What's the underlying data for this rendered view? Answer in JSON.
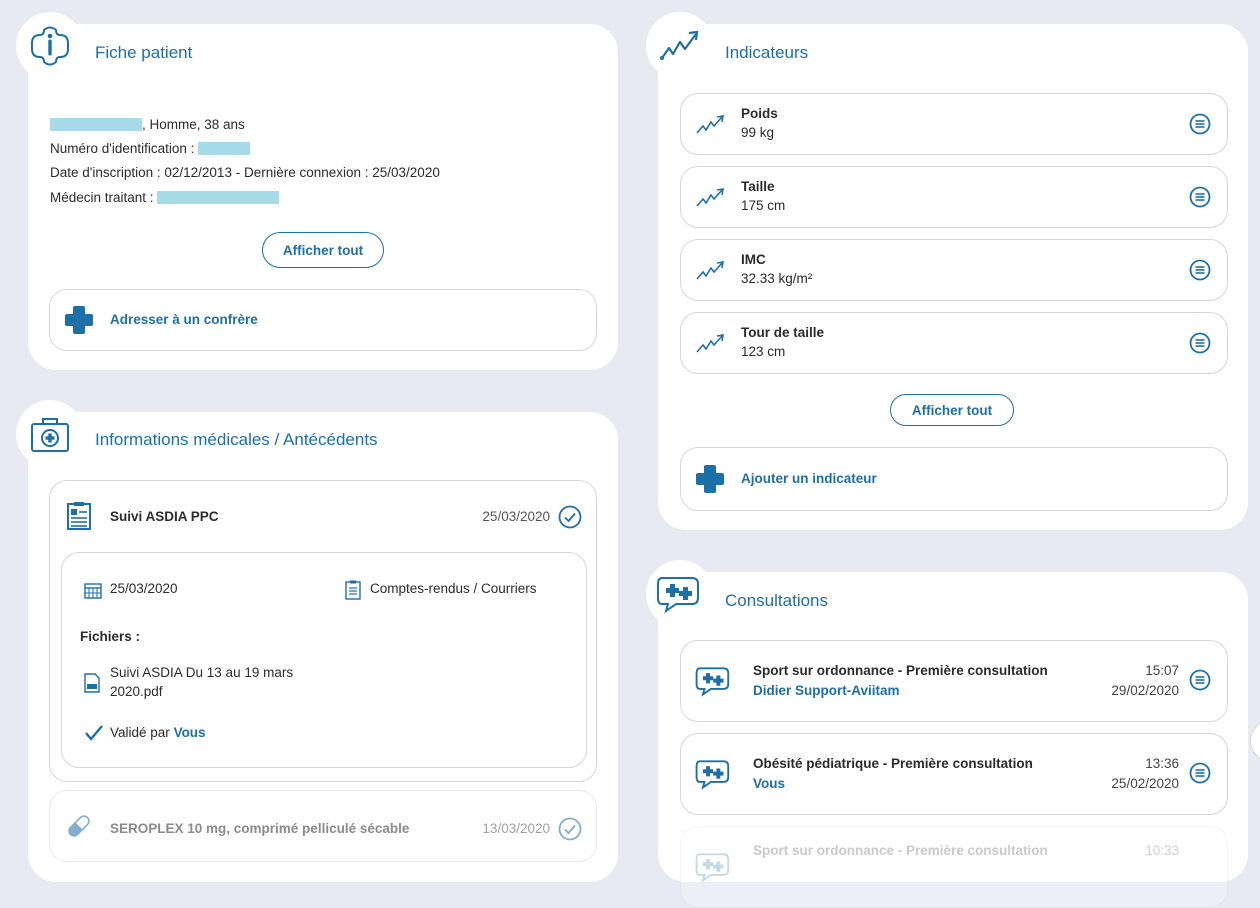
{
  "patient_card": {
    "title": "Fiche patient",
    "gender_age": ", Homme, 38 ans",
    "id_label": "Numéro d'identification :",
    "registration_line": "Date d'inscription : 02/12/2013 - Dernière connexion : 25/03/2020",
    "doctor_label": "Médecin traitant :",
    "show_all": "Afficher tout",
    "refer_action": "Adresser à un confrère"
  },
  "medical_card": {
    "title": "Informations médicales / Antécédents",
    "entry1": {
      "title": "Suivi ASDIA PPC",
      "date": "25/03/2020",
      "detail_date": "25/03/2020",
      "category": "Comptes-rendus / Courriers",
      "files_label": "Fichiers :",
      "file_line1": "Suivi ASDIA Du 13 au 19 mars",
      "file_line2": "2020.pdf",
      "validated_prefix": "Validé par",
      "validated_by": "Vous"
    },
    "entry2": {
      "title": "SEROPLEX 10 mg, comprimé pelliculé sécable",
      "date": "13/03/2020"
    }
  },
  "indicators_card": {
    "title": "Indicateurs",
    "items": [
      {
        "name": "Poids",
        "value": "99 kg"
      },
      {
        "name": "Taille",
        "value": "175 cm"
      },
      {
        "name": "IMC",
        "value": "32.33 kg/m²"
      },
      {
        "name": "Tour de taille",
        "value": "123 cm"
      }
    ],
    "show_all": "Afficher tout",
    "add_action": "Ajouter un indicateur"
  },
  "consultations_card": {
    "title": "Consultations",
    "items": [
      {
        "title": "Sport sur ordonnance - Première consultation",
        "who": "Didier Support-Aviitam",
        "time": "15:07",
        "date": "29/02/2020"
      },
      {
        "title": "Obésité pédiatrique - Première consultation",
        "who": "Vous",
        "time": "13:36",
        "date": "25/02/2020"
      },
      {
        "title": "Sport sur ordonnance - Première consultation",
        "time": "10:33"
      }
    ]
  },
  "colors": {
    "accent": "#1d6fa8",
    "background": "#e9e9f3",
    "redaction": "#a8dbe8",
    "check": "#1d6fa8"
  }
}
